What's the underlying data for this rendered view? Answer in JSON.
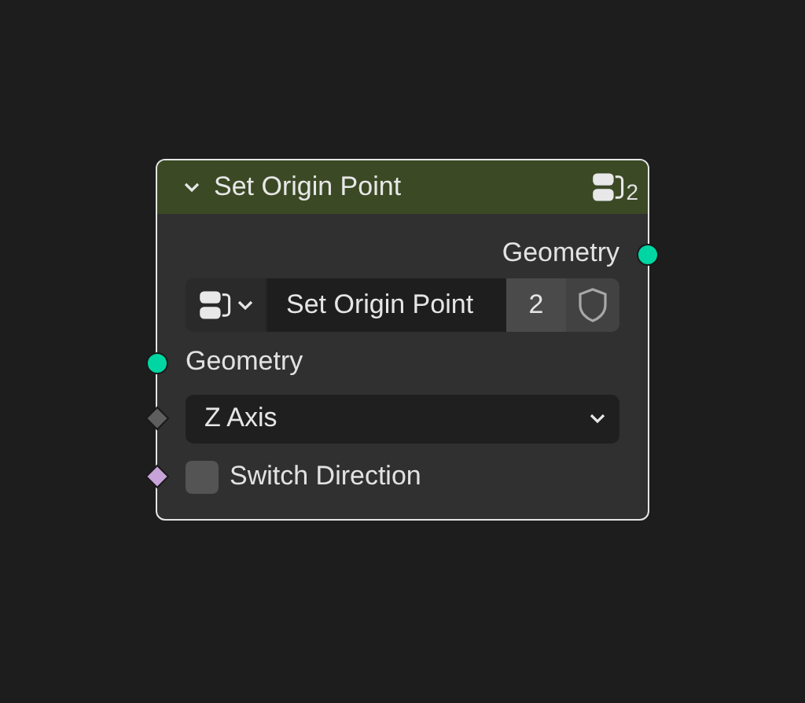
{
  "node": {
    "title": "Set Origin Point",
    "expanded": true,
    "user_count": "2",
    "outputs": [
      {
        "label": "Geometry",
        "color": "#00d6a3"
      }
    ],
    "datablock": {
      "name": "Set Origin Point",
      "users": "2",
      "fake_user": false
    },
    "inputs": [
      {
        "kind": "socket",
        "label": "Geometry",
        "color": "#00d6a3"
      },
      {
        "kind": "dropdown",
        "value": "Z Axis",
        "color": "#5e5e5e"
      },
      {
        "kind": "checkbox",
        "label": "Switch Direction",
        "checked": false,
        "color": "#c7a3da"
      }
    ]
  }
}
